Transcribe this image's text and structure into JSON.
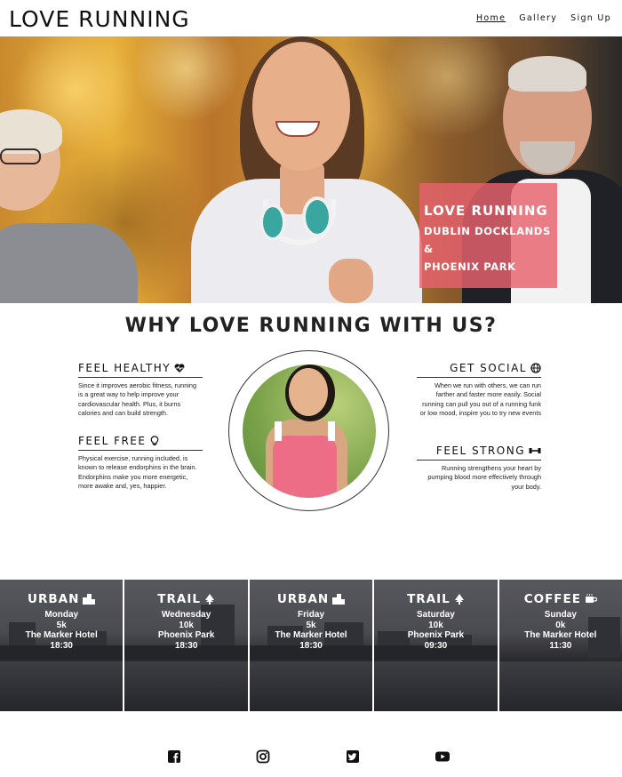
{
  "header": {
    "logo": "LOVE RUNNING",
    "nav": [
      {
        "label": "Home",
        "active": true
      },
      {
        "label": "Gallery",
        "active": false
      },
      {
        "label": "Sign Up",
        "active": false
      }
    ]
  },
  "hero": {
    "badge_title": "LOVE RUNNING",
    "badge_line1": "DUBLIN DOCKLANDS &",
    "badge_line2": "PHOENIX PARK",
    "badge_color": "#e8626e"
  },
  "why": {
    "title": "WHY LOVE RUNNING WITH US?",
    "features": [
      {
        "title": "FEEL HEALTHY",
        "icon": "heartbeat-icon",
        "text": "Since it improves aerobic fitness, running is a great way to help improve your cardiovascular health. Plus, it burns calories and can build strength."
      },
      {
        "title": "FEEL FREE",
        "icon": "lightbulb-icon",
        "text": "Physical exercise, running included, is known to release endorphins in the brain. Endorphins make you more energetic, more awake and, yes, happier."
      },
      {
        "title": "GET SOCIAL",
        "icon": "globe-icon",
        "text": "When we run with others, we can run farther and faster more easily. Social running can pull you out of a running funk or low mood, inspire you to try new events"
      },
      {
        "title": "FEEL STRONG",
        "icon": "dumbbell-icon",
        "text": "Running strengthens your heart by pumping blood more effectively through your body."
      }
    ]
  },
  "schedule": [
    {
      "type": "URBAN",
      "icon": "city-icon",
      "day": "Monday",
      "distance": "5k",
      "location": "The Marker Hotel",
      "time": "18:30"
    },
    {
      "type": "TRAIL",
      "icon": "tree-icon",
      "day": "Wednesday",
      "distance": "10k",
      "location": "Phoenix Park",
      "time": "18:30"
    },
    {
      "type": "URBAN",
      "icon": "city-icon",
      "day": "Friday",
      "distance": "5k",
      "location": "The Marker Hotel",
      "time": "18:30"
    },
    {
      "type": "TRAIL",
      "icon": "tree-icon",
      "day": "Saturday",
      "distance": "10k",
      "location": "Phoenix Park",
      "time": "09:30"
    },
    {
      "type": "COFFEE",
      "icon": "coffee-icon",
      "day": "Sunday",
      "distance": "0k",
      "location": "The Marker Hotel",
      "time": "11:30"
    }
  ],
  "footer": {
    "social": [
      "facebook-icon",
      "instagram-icon",
      "twitter-icon",
      "youtube-icon"
    ]
  }
}
